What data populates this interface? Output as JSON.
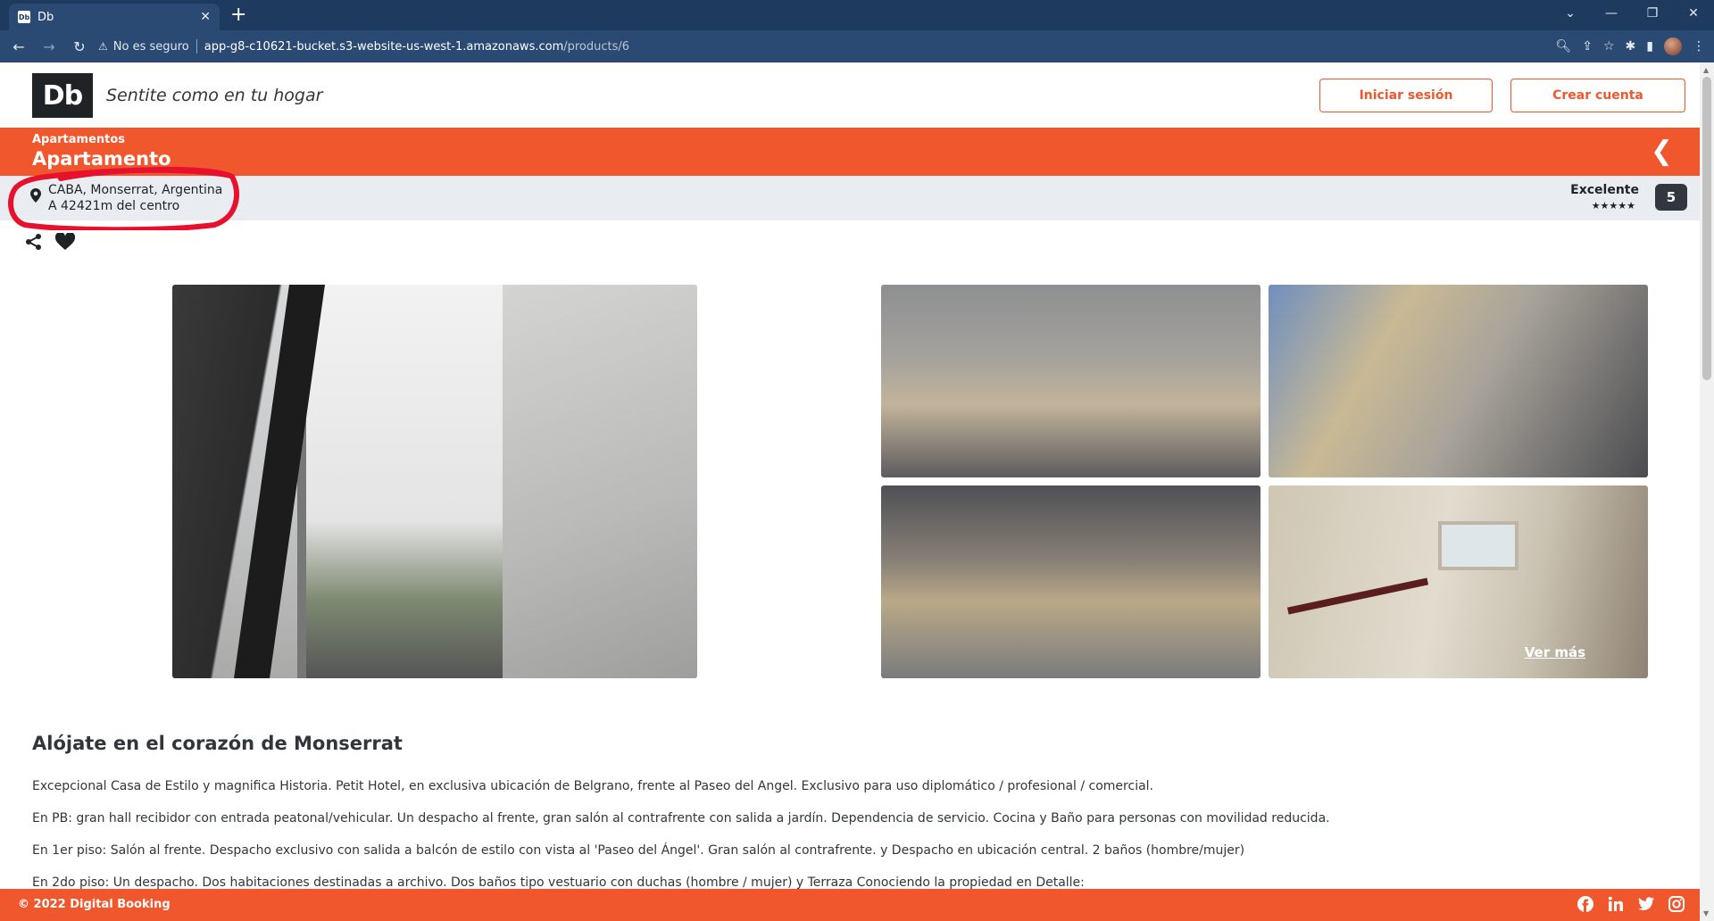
{
  "browser": {
    "tab_title": "Db",
    "tab_favicon": "Db",
    "security_label": "No es seguro",
    "url_host": "app-g8-c10621-bucket.s3-website-us-west-1.amazonaws.com",
    "url_path": "/products/6"
  },
  "header": {
    "logo": "Db",
    "slogan": "Sentite como en tu hogar",
    "login_label": "Iniciar sesión",
    "signup_label": "Crear cuenta"
  },
  "product": {
    "category": "Apartamentos",
    "name": "Apartamento",
    "location": "CABA, Monserrat, Argentina",
    "distance": "A 42421m del centro",
    "rating_word": "Excelente",
    "rating_stars": "★★★★★",
    "rating_score": "5"
  },
  "gallery": {
    "see_more_label": "Ver más"
  },
  "description": {
    "title": "Alójate en el corazón de Monserrat",
    "paragraphs": [
      "Excepcional Casa de Estilo y magnifica Historia. Petit Hotel, en exclusiva ubicación de Belgrano, frente al Paseo del Angel. Exclusivo para uso diplomático / profesional / comercial.",
      "En PB: gran hall recibidor con entrada peatonal/vehicular. Un despacho al frente, gran salón al contrafrente con salida a jardín. Dependencia de servicio. Cocina y Baño para personas con movilidad reducida.",
      "En 1er piso: Salón al frente. Despacho exclusivo con salida a balcón de estilo con vista al 'Paseo del Ángel'. Gran salón al contrafrente. y Despacho en ubicación central. 2 baños (hombre/mujer)",
      "En 2do piso: Un despacho. Dos habitaciones destinadas a archivo. Dos baños tipo vestuario con duchas (hombre / mujer) y Terraza Conociendo la propiedad en Detalle:"
    ]
  },
  "footer": {
    "copyright": "© 2022 Digital Booking"
  },
  "colors": {
    "accent": "#f0572d",
    "dark": "#1f2326",
    "browser_chrome": "#1e3a5f",
    "annotation_red": "#e8112d"
  }
}
